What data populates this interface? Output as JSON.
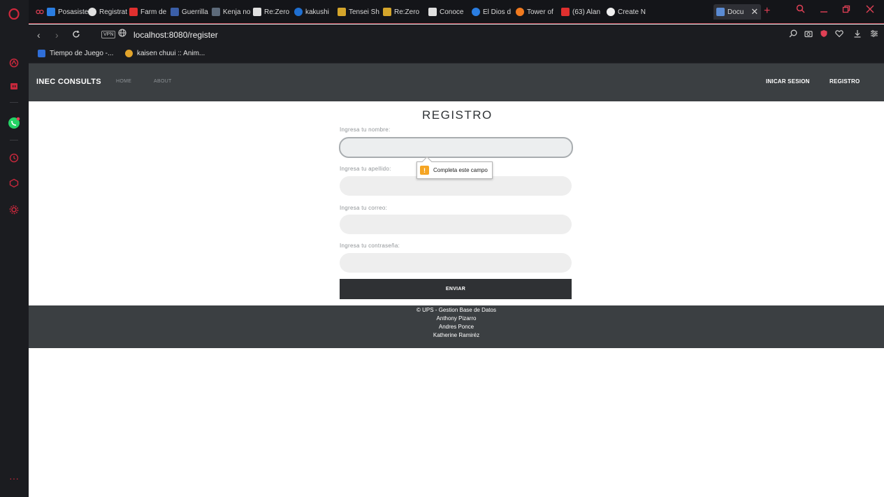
{
  "tabs": [
    {
      "label": "Posasiste",
      "color": "#2a7de1"
    },
    {
      "label": "Registrat",
      "color": "#e0e0e0"
    },
    {
      "label": "Farm de",
      "color": "#e0302f"
    },
    {
      "label": "Guerrilla",
      "color": "#3b5fa8"
    },
    {
      "label": "Kenja no",
      "color": "#5d6a7a"
    },
    {
      "label": "Re:Zero",
      "color": "#e0e0e0"
    },
    {
      "label": "kakushi",
      "color": "#1f6fd1"
    },
    {
      "label": "Tensei Sh",
      "color": "#d4a52b"
    },
    {
      "label": "Re:Zero",
      "color": "#d4a52b"
    },
    {
      "label": "Conoce",
      "color": "#e0e0e0"
    },
    {
      "label": "El Dios d",
      "color": "#2a7de1"
    },
    {
      "label": "Tower of",
      "color": "#f17a1f"
    },
    {
      "label": "(63) Alan",
      "color": "#e0302f"
    },
    {
      "label": "Create N",
      "color": "#f0f0f0"
    },
    {
      "label": "Docu",
      "color": "#5b8bd3"
    }
  ],
  "address_bar": {
    "vpn_label": "VPN",
    "url": "localhost:8080/register"
  },
  "bookmarks": [
    {
      "label": "Tiempo de Juego -...",
      "color": "#2f6ed8"
    },
    {
      "label": "kaisen chuui :: Anim...",
      "color": "#e2a42b"
    }
  ],
  "site_nav": {
    "brand": "INEC CONSULTS",
    "home": "HOME",
    "about": "ABOUT",
    "login": "INICAR SESION",
    "register": "REGISTRO"
  },
  "form": {
    "title": "REGISTRO",
    "name_label": "Ingresa tu nombre:",
    "surname_label": "Ingresa tu apellido:",
    "email_label": "Ingresa tu correo:",
    "password_label": "Ingresa tu contraseña:",
    "submit_label": "ENVIAR",
    "validation_message": "Completa este campo"
  },
  "footer": {
    "line1": "© UPS - Gestion Base de Datos",
    "line2": "Anthony Pizarro",
    "line3": "Andres Ponce",
    "line4": "Katherine Ramiréz"
  },
  "colors": {
    "accent": "#e04055",
    "navbar_bg": "#3b3f42",
    "button_bg": "#2f3134"
  }
}
